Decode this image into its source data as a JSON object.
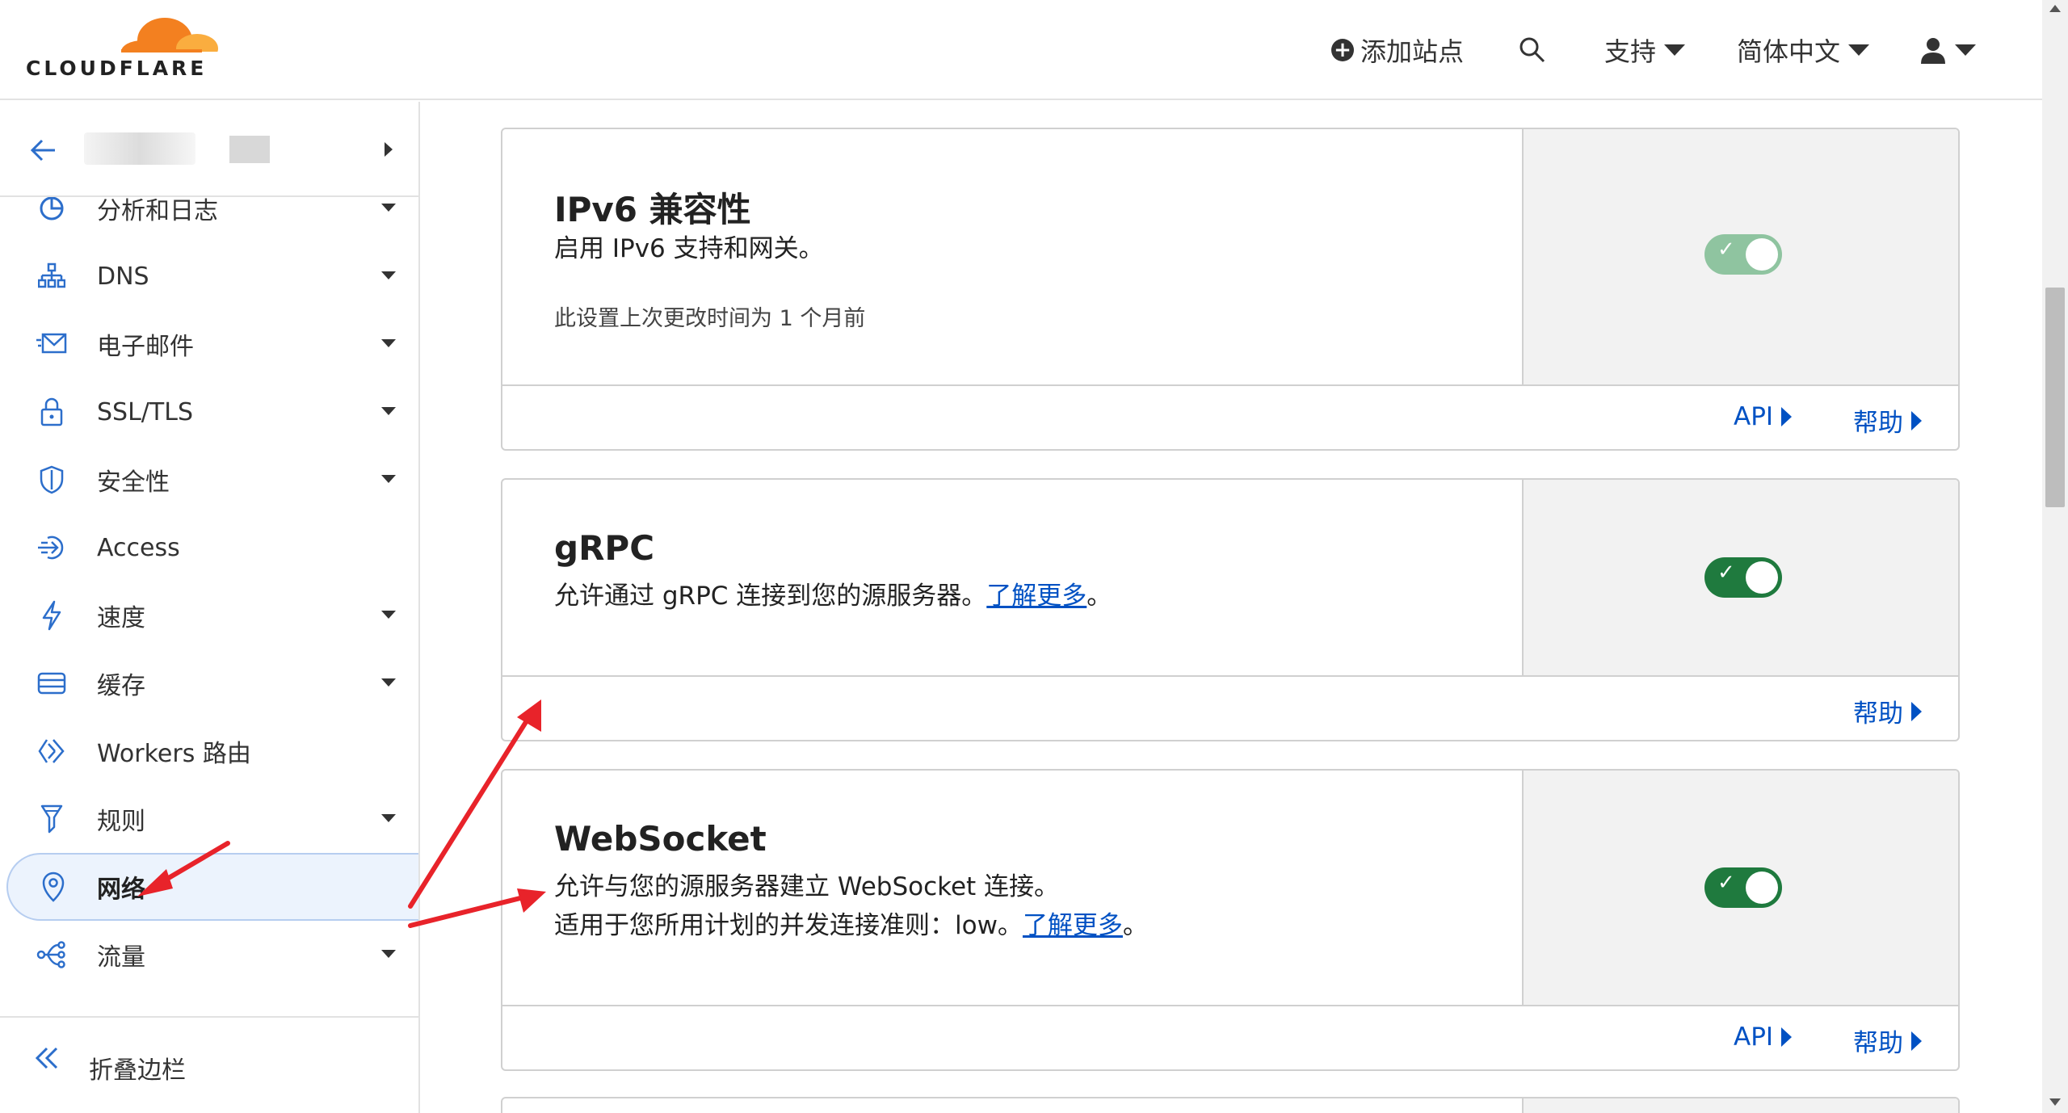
{
  "header": {
    "logo_text": "CLOUDFLARE",
    "add_site": "添加站点",
    "support": "支持",
    "language": "简体中文"
  },
  "sidebar": {
    "items": [
      {
        "label": "分析和日志",
        "icon": "pie-chart-icon",
        "dropdown": true
      },
      {
        "label": "DNS",
        "icon": "network-tree-icon",
        "dropdown": true
      },
      {
        "label": "电子邮件",
        "icon": "email-icon",
        "dropdown": true
      },
      {
        "label": "SSL/TLS",
        "icon": "lock-icon",
        "dropdown": true
      },
      {
        "label": "安全性",
        "icon": "shield-icon",
        "dropdown": true
      },
      {
        "label": "Access",
        "icon": "access-icon",
        "dropdown": false
      },
      {
        "label": "速度",
        "icon": "lightning-icon",
        "dropdown": true
      },
      {
        "label": "缓存",
        "icon": "cache-icon",
        "dropdown": true
      },
      {
        "label": "Workers 路由",
        "icon": "workers-icon",
        "dropdown": false
      },
      {
        "label": "规则",
        "icon": "rules-icon",
        "dropdown": true
      },
      {
        "label": "网络",
        "icon": "location-pin-icon",
        "dropdown": false,
        "active": true
      },
      {
        "label": "流量",
        "icon": "traffic-icon",
        "dropdown": true
      }
    ],
    "collapse": "折叠边栏"
  },
  "cards": [
    {
      "title": "IPv6 兼容性",
      "desc": "启用 IPv6 支持和网关。",
      "note": "此设置上次更改时间为 1 个月前",
      "toggle": "on",
      "api": "API",
      "help": "帮助"
    },
    {
      "title": "gRPC",
      "desc_pre": "允许通过 gRPC 连接到您的源服务器。",
      "link": "了解更多",
      "desc_post": "。",
      "toggle": "on",
      "help": "帮助"
    },
    {
      "title": "WebSocket",
      "desc1": "允许与您的源服务器建立 WebSocket 连接。",
      "desc2_pre": "适用于您所用计划的并发连接准则：low。",
      "link": "了解更多",
      "desc2_post": "。",
      "toggle": "on",
      "api": "API",
      "help": "帮助"
    }
  ],
  "colors": {
    "accent": "#0051c3",
    "toggle_on": "#1f7a3e",
    "annotation": "#e8232a",
    "logo_orange": "#f38020"
  }
}
